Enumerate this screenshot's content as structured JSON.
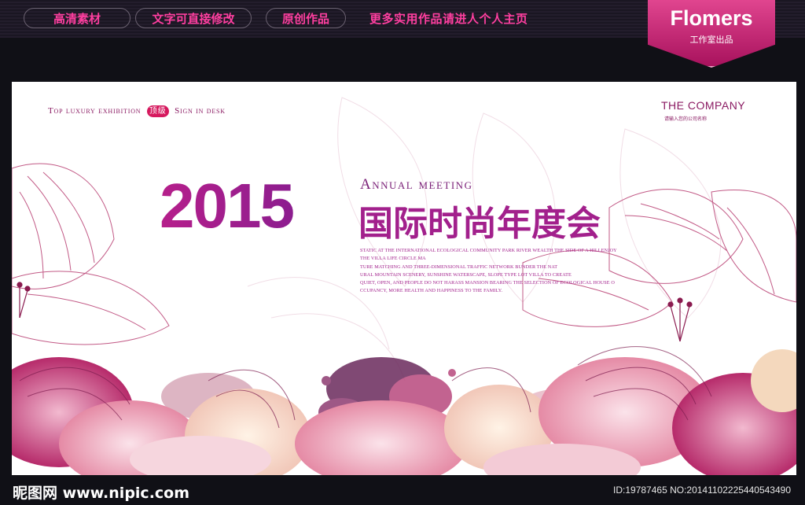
{
  "top_banner": {
    "tags": [
      "高清素材",
      "文字可直接修改",
      "原创作品"
    ],
    "more_text": "更多实用作品请进人个人主页"
  },
  "logo": {
    "name": "Flomers",
    "sub": "工作室出品"
  },
  "poster": {
    "luxury_prefix": "Top luxury exhibition",
    "luxury_badge": "顶级",
    "luxury_suffix": "Sign in desk",
    "company": "THE COMPANY",
    "company_sub": "请输入您的公司名称",
    "year": "2015",
    "annual": "Annual meeting",
    "cn_title": "国际时尚年度会",
    "paragraph": [
      "STATIC AT THE INTERNATIONAL ECOLOGICAL COMMUNITY PARK RIVER WEALTH THE SIDE OF A HILLENJOY",
      "THE VILLA LIFE CIRCLE MA",
      "TURE MATCHING AND THREE-DIMENSIONAL TRAFFIC NETWORK BUNDER THE NAT",
      "URAL MOUNTAIN SCENERY, SUNSHINE WATERSCAPE, SLOPE TYPE LOT VILLA TO CREATE",
      "QUIET, OPEN, AND PEOPLE DO NOT HARASS MANSION BEARING THE SELECTION OF ECOLOGICAL HOUSE O",
      "CCUPANCY, MORE HEALTH AND HAPPINESS TO THE FAMILY."
    ]
  },
  "footer": {
    "site": "昵图网 www.nipic.com",
    "id_line": "ID:19787465 NO:20141102225440543490"
  },
  "colors": {
    "accent": "#a2208c",
    "banner_text": "#ff3fa0",
    "logo_bg": "#c4206f"
  }
}
